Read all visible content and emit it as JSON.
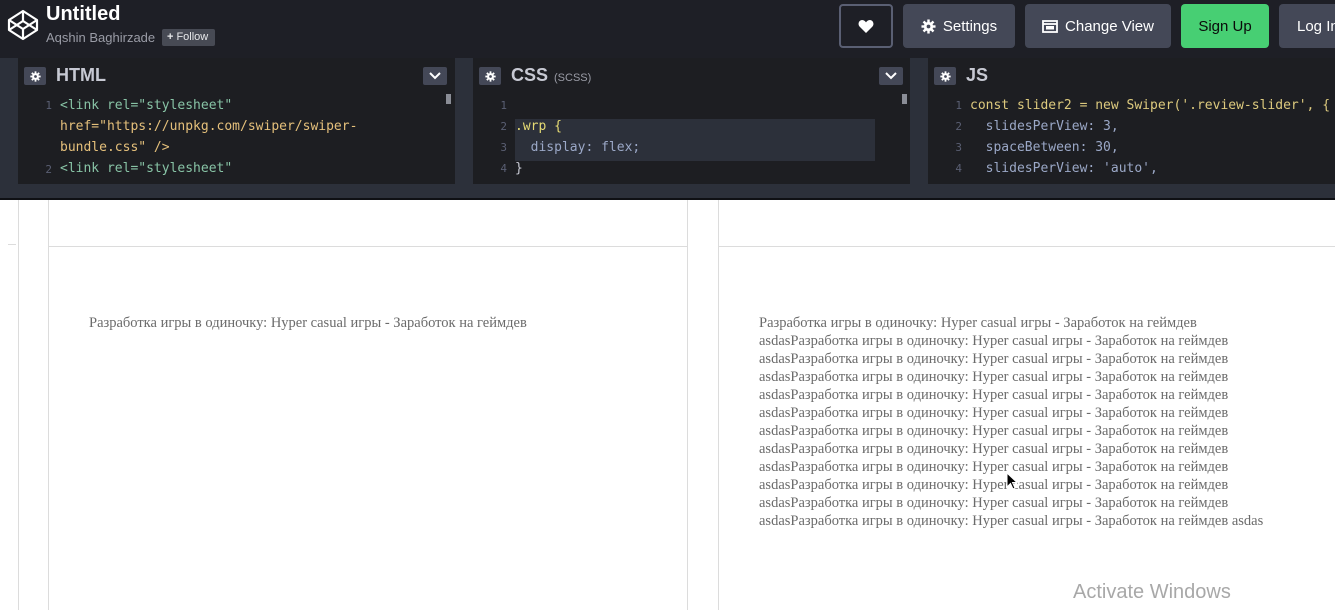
{
  "header": {
    "title": "Untitled",
    "author": "Aqshin Baghirzade",
    "follow_label": "Follow",
    "buttons": {
      "settings": "Settings",
      "change_view": "Change View",
      "sign_up": "Sign Up",
      "log_in": "Log In"
    }
  },
  "panels": {
    "html": {
      "title": "HTML",
      "lines": [
        "1",
        "2"
      ]
    },
    "css": {
      "title": "CSS",
      "subtitle": "(SCSS)",
      "lines": [
        "1",
        "2",
        "3",
        "4"
      ]
    },
    "js": {
      "title": "JS",
      "lines": [
        "1",
        "2",
        "3",
        "4"
      ]
    }
  },
  "code": {
    "html_l1": "<link rel=\"stylesheet\"",
    "html_l1b": "href=\"https://unpkg.com/swiper/swiper-",
    "html_l1c": "bundle.css\" />",
    "html_l2": "<link rel=\"stylesheet\"",
    "css_l2": ".wrp {",
    "css_l3": "  display: flex;",
    "css_l4": "}",
    "js_l1": "const slider2 = new Swiper('.review-slider', {",
    "js_l2": "  slidesPerView: 3,",
    "js_l3": "  spaceBetween: 30,",
    "js_l4": "  slidesPerView: 'auto',"
  },
  "preview": {
    "left_text": "Разработка игры в одиночку: Hyper casual игры - Заработок на геймдев",
    "right_lines": [
      "Разработка игры в одиночку: Hyper casual игры - Заработок на геймдев",
      "asdasРазработка игры в одиночку: Hyper casual игры - Заработок на геймдев",
      "asdasРазработка игры в одиночку: Hyper casual игры - Заработок на геймдев",
      "asdasРазработка игры в одиночку: Hyper casual игры - Заработок на геймдев",
      "asdasРазработка игры в одиночку: Hyper casual игры - Заработок на геймдев",
      "asdasРазработка игры в одиночку: Hyper casual игры - Заработок на геймдев",
      "asdasРазработка игры в одиночку: Hyper casual игры - Заработок на геймдев",
      "asdasРазработка игры в одиночку: Hyper casual игры - Заработок на геймдев",
      "asdasРазработка игры в одиночку: Hyper casual игры - Заработок на геймдев",
      "asdasРазработка игры в одиночку: Hyper casual игры - Заработок на геймдев",
      "asdasРазработка игры в одиночку: Hyper casual игры - Заработок на геймдев",
      "asdasРазработка игры в одиночку: Hyper casual игры - Заработок на геймдев asdas"
    ],
    "watermark": "Activate Windows"
  },
  "colors": {
    "header_bg": "#1e1f26",
    "button_bg": "#444857",
    "signup_bg": "#47cf73",
    "editor_bg": "#1d1e22"
  }
}
